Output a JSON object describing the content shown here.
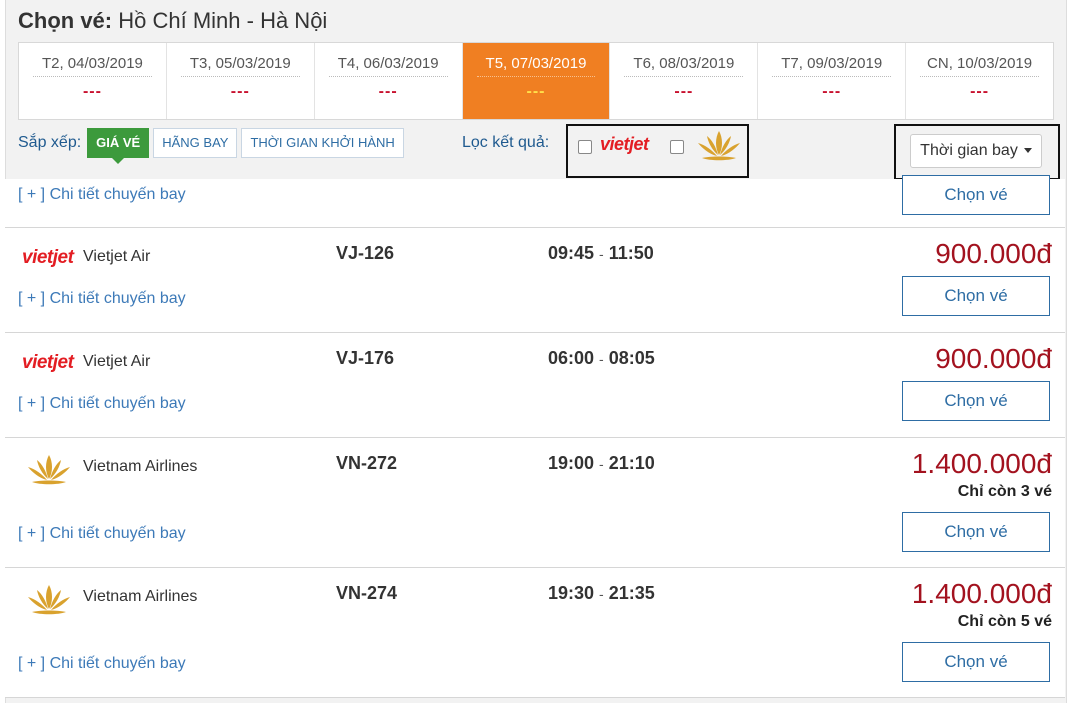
{
  "header": {
    "title_prefix": "Chọn vé:",
    "title_route": "Hồ Chí Minh - Hà Nội"
  },
  "dates": [
    {
      "label": "T2, 04/03/2019",
      "price": "---",
      "active": false
    },
    {
      "label": "T3, 05/03/2019",
      "price": "---",
      "active": false
    },
    {
      "label": "T4, 06/03/2019",
      "price": "---",
      "active": false
    },
    {
      "label": "T5, 07/03/2019",
      "price": "---",
      "active": true
    },
    {
      "label": "T6, 08/03/2019",
      "price": "---",
      "active": false
    },
    {
      "label": "T7, 09/03/2019",
      "price": "---",
      "active": false
    },
    {
      "label": "CN, 10/03/2019",
      "price": "---",
      "active": false
    }
  ],
  "sort": {
    "label": "Sắp xếp:",
    "options": [
      "GIÁ VÉ",
      "HÃNG BAY",
      "THỜI GIAN KHỞI HÀNH"
    ],
    "active_index": 0
  },
  "filter": {
    "label": "Lọc kết quả:",
    "vietjet_logo_text": "vietjet"
  },
  "sort_dropdown": {
    "value": "Thời gian bay"
  },
  "top_partial": {
    "detail": "[ + ] Chi tiết chuyến bay",
    "choose": "Chọn vé"
  },
  "flights": [
    {
      "airline": "Vietjet Air",
      "logo": "vietjet-logo",
      "code": "VJ-126",
      "depart": "09:45",
      "arrive": "11:50",
      "dash": "-",
      "price": "900.000đ",
      "remaining": "",
      "detail": "[ + ] Chi tiết chuyến bay",
      "choose": "Chọn vé"
    },
    {
      "airline": "Vietjet Air",
      "logo": "vietjet-logo",
      "code": "VJ-176",
      "depart": "06:00",
      "arrive": "08:05",
      "dash": "-",
      "price": "900.000đ",
      "remaining": "",
      "detail": "[ + ] Chi tiết chuyến bay",
      "choose": "Chọn vé"
    },
    {
      "airline": "Vietnam Airlines",
      "logo": "lotus-logo",
      "code": "VN-272",
      "depart": "19:00",
      "arrive": "21:10",
      "dash": "-",
      "price": "1.400.000đ",
      "remaining": "Chỉ còn 3 vé",
      "detail": "[ + ] Chi tiết chuyến bay",
      "choose": "Chọn vé"
    },
    {
      "airline": "Vietnam Airlines",
      "logo": "lotus-logo",
      "code": "VN-274",
      "depart": "19:30",
      "arrive": "21:35",
      "dash": "-",
      "price": "1.400.000đ",
      "remaining": "Chỉ còn 5 vé",
      "detail": "[ + ] Chi tiết chuyến bay",
      "choose": "Chọn vé"
    }
  ],
  "colors": {
    "active_date": "#f07f22",
    "active_sort": "#3c9a3c",
    "price": "#a3121f",
    "link": "#3d7ab8"
  }
}
